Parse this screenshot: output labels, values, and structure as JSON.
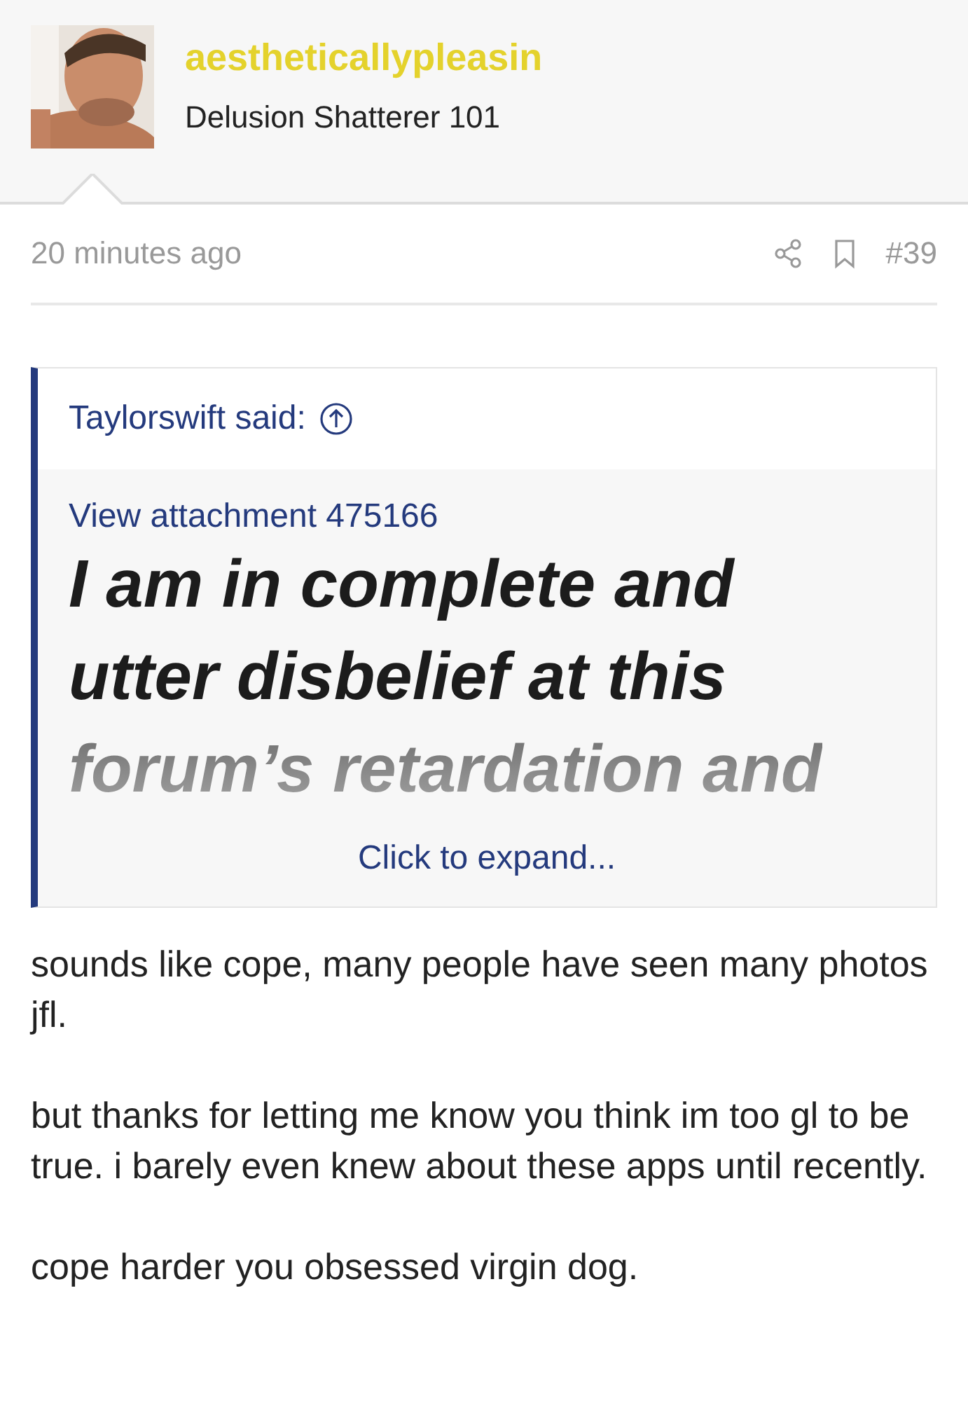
{
  "author": {
    "username": "aestheticallypleasin",
    "title": "Delusion Shatterer 101"
  },
  "post_meta": {
    "time": "20 minutes ago",
    "number": "#39"
  },
  "quote": {
    "author_line": "Taylorswift said:",
    "attachment_link": "View attachment 475166",
    "lines": [
      {
        "text": "I am in complete and",
        "faded": false
      },
      {
        "text": "utter disbelief at this",
        "faded": false
      },
      {
        "text": "forum’s retardation and",
        "faded": true
      }
    ],
    "expand_link": "Click to expand..."
  },
  "body": [
    "sounds like cope, many people have seen many photos jfl.",
    "but thanks for letting me know you think im too gl to be true. i barely even knew about these apps until recently.",
    "cope harder you obsessed virgin dog."
  ]
}
